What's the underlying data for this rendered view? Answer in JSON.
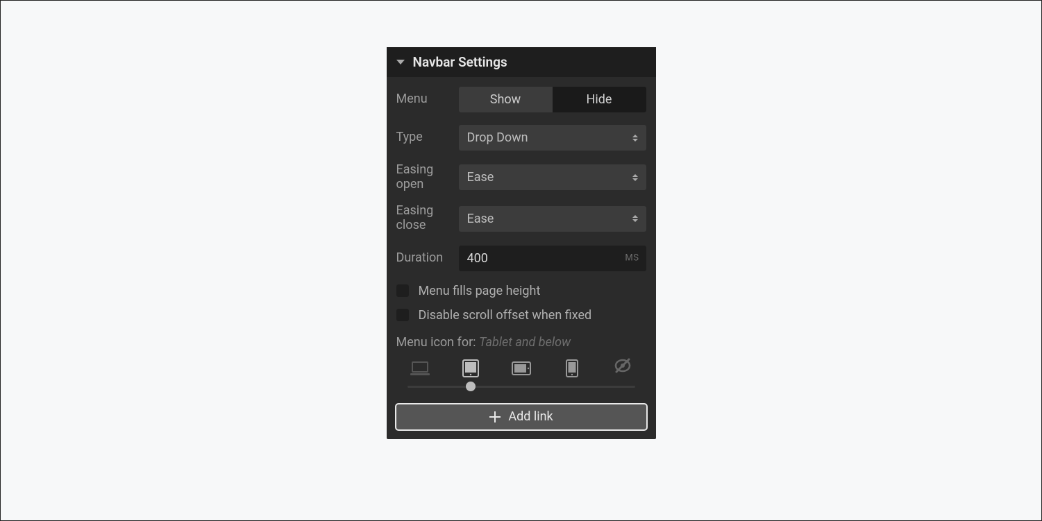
{
  "panel": {
    "title": "Navbar Settings",
    "menu": {
      "label": "Menu",
      "show_label": "Show",
      "hide_label": "Hide",
      "active": "show"
    },
    "type": {
      "label": "Type",
      "value": "Drop Down"
    },
    "easing_open": {
      "label": "Easing open",
      "value": "Ease"
    },
    "easing_close": {
      "label": "Easing close",
      "value": "Ease"
    },
    "duration": {
      "label": "Duration",
      "value": "400",
      "unit": "MS"
    },
    "checks": {
      "fills_height": "Menu fills page height",
      "disable_scroll": "Disable scroll offset when fixed"
    },
    "menu_icon_for": {
      "label": "Menu icon for:",
      "value": "Tablet and below"
    },
    "add_link_label": "Add link"
  }
}
